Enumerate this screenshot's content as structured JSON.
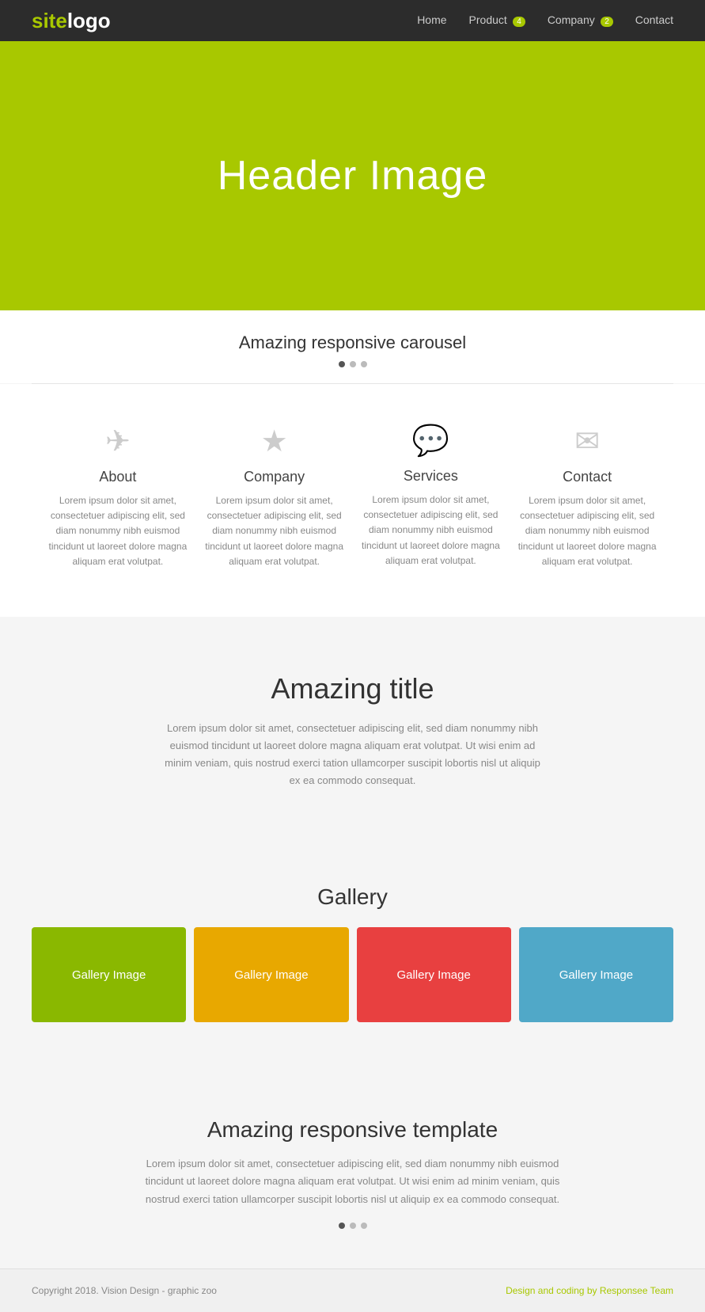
{
  "navbar": {
    "logo_site": "site",
    "logo_logo": "logo",
    "nav_items": [
      {
        "label": "Home",
        "badge": null
      },
      {
        "label": "Product",
        "badge": "4"
      },
      {
        "label": "Company",
        "badge": "2"
      },
      {
        "label": "Contact",
        "badge": null
      }
    ]
  },
  "hero": {
    "title": "Header Image"
  },
  "carousel": {
    "title": "Amazing responsive carousel",
    "dots": [
      "active",
      "inactive",
      "inactive"
    ]
  },
  "features": [
    {
      "icon": "✈",
      "title": "About",
      "text": "Lorem ipsum dolor sit amet, consectetuer adipiscing elit, sed diam nonummy nibh euismod tincidunt ut laoreet dolore magna aliquam erat volutpat."
    },
    {
      "icon": "★",
      "title": "Company",
      "text": "Lorem ipsum dolor sit amet, consectetuer adipiscing elit, sed diam nonummy nibh euismod tincidunt ut laoreet dolore magna aliquam erat volutpat."
    },
    {
      "icon": "💬",
      "title": "Services",
      "text": "Lorem ipsum dolor sit amet, consectetuer adipiscing elit, sed diam nonummy nibh euismod tincidunt ut laoreet dolore magna aliquam erat volutpat."
    },
    {
      "icon": "✉",
      "title": "Contact",
      "text": "Lorem ipsum dolor sit amet, consectetuer adipiscing elit, sed diam nonummy nibh euismod tincidunt ut laoreet dolore magna aliquam erat volutpat."
    }
  ],
  "amazing_title": {
    "title": "Amazing title",
    "text": "Lorem ipsum dolor sit amet, consectetuer adipiscing elit, sed diam nonummy nibh euismod tincidunt ut laoreet dolore magna aliquam erat volutpat. Ut wisi enim ad minim veniam, quis nostrud exerci tation ullamcorper suscipit lobortis nisl ut aliquip ex ea commodo consequat."
  },
  "gallery": {
    "title": "Gallery",
    "items": [
      {
        "label": "Gallery Image",
        "color_class": "gallery-green"
      },
      {
        "label": "Gallery Image",
        "color_class": "gallery-yellow"
      },
      {
        "label": "Gallery Image",
        "color_class": "gallery-red"
      },
      {
        "label": "Gallery Image",
        "color_class": "gallery-blue"
      }
    ]
  },
  "template": {
    "title": "Amazing responsive template",
    "text": "Lorem ipsum dolor sit amet, consectetuer adipiscing elit, sed diam nonummy nibh euismod tincidunt ut laoreet dolore magna aliquam erat volutpat.\nUt wisi enim ad minim veniam, quis nostrud exerci tation ullamcorper suscipit lobortis nisl ut aliquip ex ea commodo consequat.",
    "dots": [
      "active",
      "inactive",
      "inactive"
    ]
  },
  "footer": {
    "left": "Copyright 2018. Vision Design - graphic zoo",
    "right": "Design and coding by Responsee Team"
  }
}
